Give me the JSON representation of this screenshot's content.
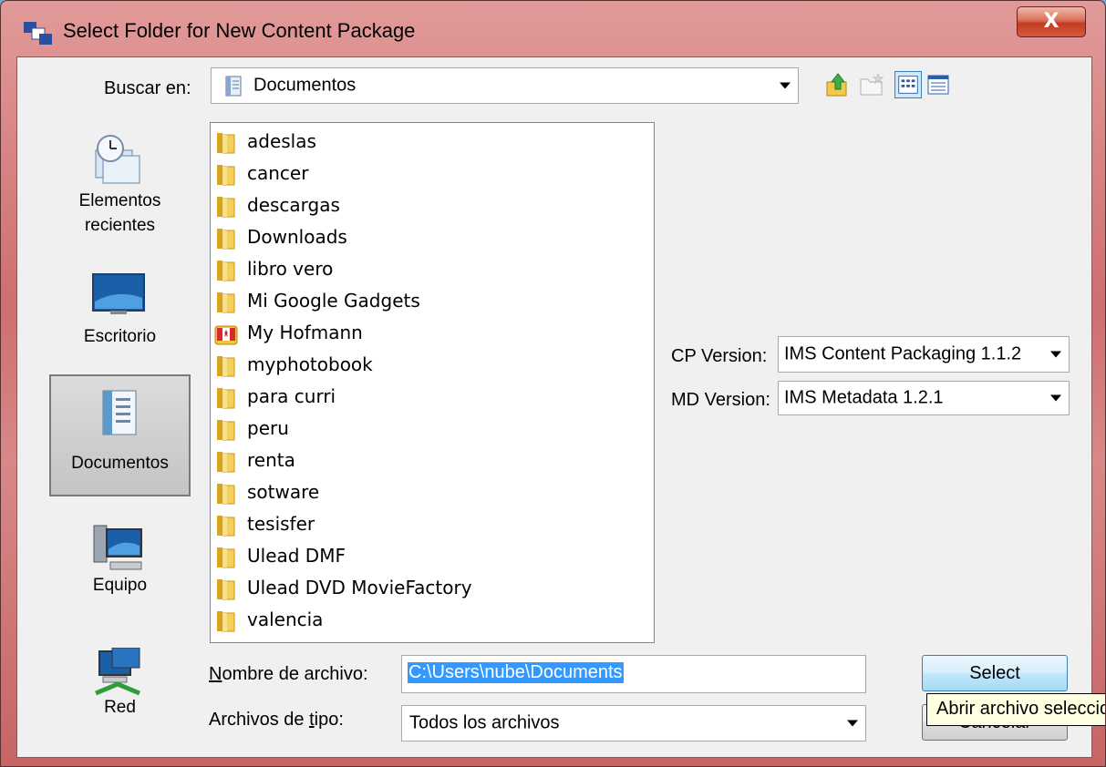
{
  "window": {
    "title": "Select Folder for New Content Package",
    "close_label": "X"
  },
  "lookin": {
    "label": "Buscar en:",
    "value": "Documentos"
  },
  "places": [
    {
      "label_line1": "Elementos",
      "label_line2": "recientes",
      "icon": "recent-items-icon"
    },
    {
      "label_line1": "Escritorio",
      "label_line2": "",
      "icon": "desktop-icon"
    },
    {
      "label_line1": "Documentos",
      "label_line2": "",
      "icon": "documents-icon",
      "selected": true
    },
    {
      "label_line1": "Equipo",
      "label_line2": "",
      "icon": "computer-icon"
    },
    {
      "label_line1": "Red",
      "label_line2": "",
      "icon": "network-icon"
    }
  ],
  "files": [
    {
      "name": "adeslas",
      "icon": "folder-icon"
    },
    {
      "name": "cancer",
      "icon": "folder-icon"
    },
    {
      "name": "descargas",
      "icon": "folder-icon"
    },
    {
      "name": "Downloads",
      "icon": "folder-icon"
    },
    {
      "name": "libro vero",
      "icon": "folder-icon"
    },
    {
      "name": "Mi Google Gadgets",
      "icon": "folder-icon"
    },
    {
      "name": "My Hofmann",
      "icon": "hofmann-app-icon"
    },
    {
      "name": "myphotobook",
      "icon": "folder-icon"
    },
    {
      "name": "para curri",
      "icon": "folder-icon"
    },
    {
      "name": "peru",
      "icon": "folder-icon"
    },
    {
      "name": "renta",
      "icon": "folder-icon"
    },
    {
      "name": "sotware",
      "icon": "folder-icon"
    },
    {
      "name": "tesisfer",
      "icon": "folder-icon"
    },
    {
      "name": "Ulead DMF",
      "icon": "folder-icon"
    },
    {
      "name": "Ulead DVD MovieFactory",
      "icon": "folder-icon"
    },
    {
      "name": "valencia",
      "icon": "folder-icon"
    }
  ],
  "cp_version": {
    "label": "CP Version:",
    "value": "IMS Content Packaging 1.1.2"
  },
  "md_version": {
    "label": "MD Version:",
    "value": "IMS Metadata 1.2.1"
  },
  "filename": {
    "label_pre": "",
    "label_u": "N",
    "label_post": "ombre de archivo:",
    "value": "C:\\Users\\nube\\Documents"
  },
  "filetype": {
    "label_pre": "Archivos de ",
    "label_u": "t",
    "label_post": "ipo:",
    "value": "Todos los archivos"
  },
  "buttons": {
    "select": "Select",
    "cancel": "Cancelar"
  },
  "tooltip": "Abrir archivo seleccionado",
  "colors": {
    "title_bar": "#d88888",
    "selection": "#3399ff",
    "default_button": "#bee6fd"
  }
}
